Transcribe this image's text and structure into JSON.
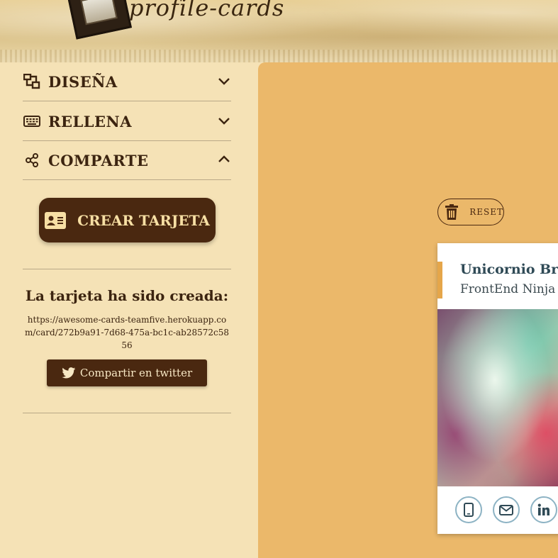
{
  "header": {
    "logo_text": "profile-cards"
  },
  "sections": [
    {
      "label": "DISEÑA",
      "icon": "layout-icon",
      "expanded": false
    },
    {
      "label": "RELLENA",
      "icon": "keyboard-icon",
      "expanded": false
    },
    {
      "label": "COMPARTE",
      "icon": "share-icon",
      "expanded": true
    }
  ],
  "create_button": {
    "label": "CREAR TARJETA",
    "icon": "id-card-icon"
  },
  "share_result": {
    "title": "La tarjeta ha sido creada:",
    "url": "https://awesome-cards-teamfive.herokuapp.com/card/272b9a91-7d68-475a-bc1c-ab28572c5856",
    "twitter_label": "Compartir en twitter"
  },
  "preview": {
    "reset_label": "RESET",
    "card": {
      "name": "Unicornio Brav",
      "job": "FrontEnd Ninja",
      "social_icons": [
        "phone-icon",
        "mail-icon",
        "linkedin-icon"
      ]
    }
  },
  "colors": {
    "panel_bg": "#f5e2b6",
    "preview_bg": "#ebb86a",
    "button_bg": "#4a2810",
    "button_text": "#f7dfa4",
    "card_accent": "#e5a64a",
    "card_name": "#2f4a56"
  }
}
